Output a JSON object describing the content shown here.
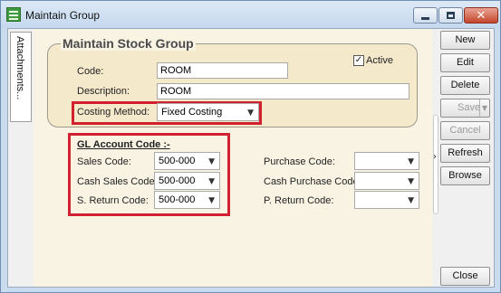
{
  "window": {
    "title": "Maintain Group"
  },
  "sidetab": {
    "label": "Attachments..."
  },
  "group": {
    "title": "Maintain Stock Group",
    "active_label": "Active",
    "active_checked": true,
    "code_label": "Code:",
    "code_value": "ROOM",
    "description_label": "Description:",
    "description_value": "ROOM",
    "costing_label": "Costing Method:",
    "costing_value": "Fixed Costing"
  },
  "gl": {
    "title": "GL Account Code :-",
    "sales_label": "Sales Code:",
    "sales_value": "500-000",
    "cash_sales_label": "Cash Sales Code:",
    "cash_sales_value": "500-000",
    "return_label": "S. Return Code:",
    "return_value": "500-000",
    "purchase_label": "Purchase Code:",
    "purchase_value": "",
    "cash_purchase_label": "Cash Purchase Code:",
    "cash_purchase_value": "",
    "p_return_label": "P. Return Code:",
    "p_return_value": ""
  },
  "buttons": {
    "new": "New",
    "edit": "Edit",
    "delete": "Delete",
    "save": "Save",
    "cancel": "Cancel",
    "refresh": "Refresh",
    "browse": "Browse",
    "close": "Close"
  },
  "colors": {
    "highlight": "#d1202f",
    "panel": "#f8f3e3",
    "group_fill": "#f5e9cc"
  }
}
